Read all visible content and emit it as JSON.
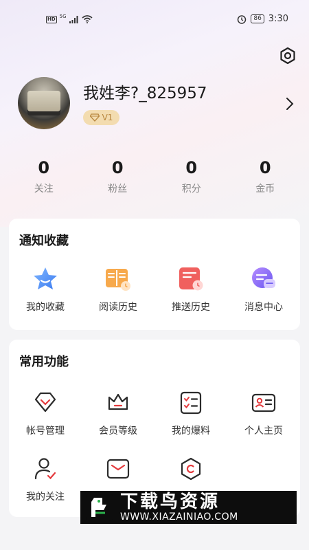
{
  "status_bar": {
    "hd": "HD",
    "network": "5G",
    "battery": "86",
    "time": "3:30"
  },
  "profile": {
    "username": "我姓李?_825957",
    "level": "V1"
  },
  "stats": [
    {
      "value": "0",
      "label": "关注"
    },
    {
      "value": "0",
      "label": "粉丝"
    },
    {
      "value": "0",
      "label": "积分"
    },
    {
      "value": "0",
      "label": "金币"
    }
  ],
  "notify_section": {
    "title": "通知收藏",
    "items": [
      {
        "label": "我的收藏",
        "icon": "star-icon"
      },
      {
        "label": "阅读历史",
        "icon": "book-icon"
      },
      {
        "label": "推送历史",
        "icon": "push-history-icon"
      },
      {
        "label": "消息中心",
        "icon": "message-icon"
      }
    ]
  },
  "common_section": {
    "title": "常用功能",
    "items": [
      {
        "label": "帐号管理",
        "icon": "account-icon"
      },
      {
        "label": "会员等级",
        "icon": "crown-icon"
      },
      {
        "label": "我的爆料",
        "icon": "checklist-icon"
      },
      {
        "label": "个人主页",
        "icon": "id-card-icon"
      },
      {
        "label": "我的关注",
        "icon": "user-check-icon"
      },
      {
        "label": "",
        "icon": "mail-icon"
      },
      {
        "label": "",
        "icon": "hexagon-icon"
      }
    ]
  },
  "watermark": {
    "title": "下载鸟资源",
    "url": "WWW.XIAZAINIAO.COM"
  },
  "colors": {
    "accent": "#e4393c",
    "vip_bg": "#f3dcb0",
    "vip_text": "#b8873f"
  }
}
